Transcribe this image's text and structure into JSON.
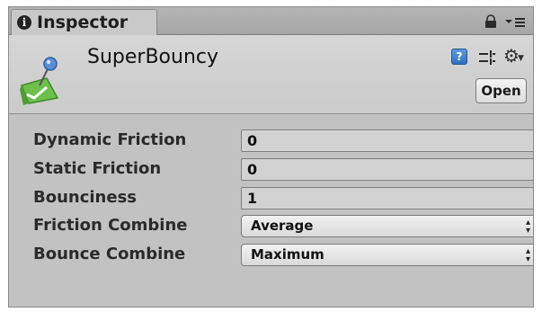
{
  "window": {
    "tab_title": "Inspector"
  },
  "header": {
    "asset_name": "SuperBouncy",
    "open_label": "Open"
  },
  "properties": [
    {
      "label": "Dynamic Friction",
      "value": "0"
    },
    {
      "label": "Static Friction",
      "value": "0"
    },
    {
      "label": "Bounciness",
      "value": "1"
    },
    {
      "label": "Friction Combine",
      "value": "Average"
    },
    {
      "label": "Bounce Combine",
      "value": "Maximum"
    }
  ],
  "icons": {
    "tab": "info-icon",
    "lock": "lock-icon",
    "tab_menu": "tab-menu-icon",
    "asset": "physic-material-icon",
    "help": "help-icon",
    "preset": "preset-icon",
    "settings": "gear-icon"
  },
  "colors": {
    "panel_bg": "#c2c2c2",
    "header_bg": "#d6d6d6",
    "field_bg": "#d2d2d2",
    "help_blue": "#2f6fc2",
    "asset_green": "#6cc04a"
  }
}
